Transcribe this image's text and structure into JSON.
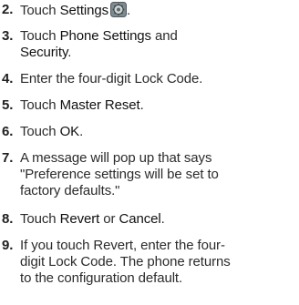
{
  "steps": [
    {
      "num": "2.",
      "pre": "Touch ",
      "kw": "Settings",
      "post": ".",
      "icon": "settings-gear-icon"
    },
    {
      "num": "3.",
      "line1_pre": "Touch ",
      "line1_kw": "Phone Settings",
      "line1_post": " and",
      "line2_kw": "Security",
      "line2_post": "."
    },
    {
      "num": "4.",
      "text": "Enter the four-digit Lock Code."
    },
    {
      "num": "5.",
      "pre": "Touch ",
      "kw": "Master Reset",
      "post": "."
    },
    {
      "num": "6.",
      "pre": "Touch ",
      "kw": "OK",
      "post": "."
    },
    {
      "num": "7.",
      "line1": "A message will pop up that says",
      "line2": "\"Preference settings will be set to",
      "line3": "factory defaults.\""
    },
    {
      "num": "8.",
      "pre": "Touch ",
      "kw1": "Revert",
      "mid": " or ",
      "kw2": "Cancel",
      "post": "."
    },
    {
      "num": "9.",
      "line1": "If you touch Revert, enter the four-",
      "line2": "digit Lock Code. The phone returns",
      "line3": "to the configuration default."
    }
  ],
  "colors": {
    "text": "#2b2b2b",
    "background": "#ffffff",
    "icon_bg": "#7d8a8f"
  }
}
